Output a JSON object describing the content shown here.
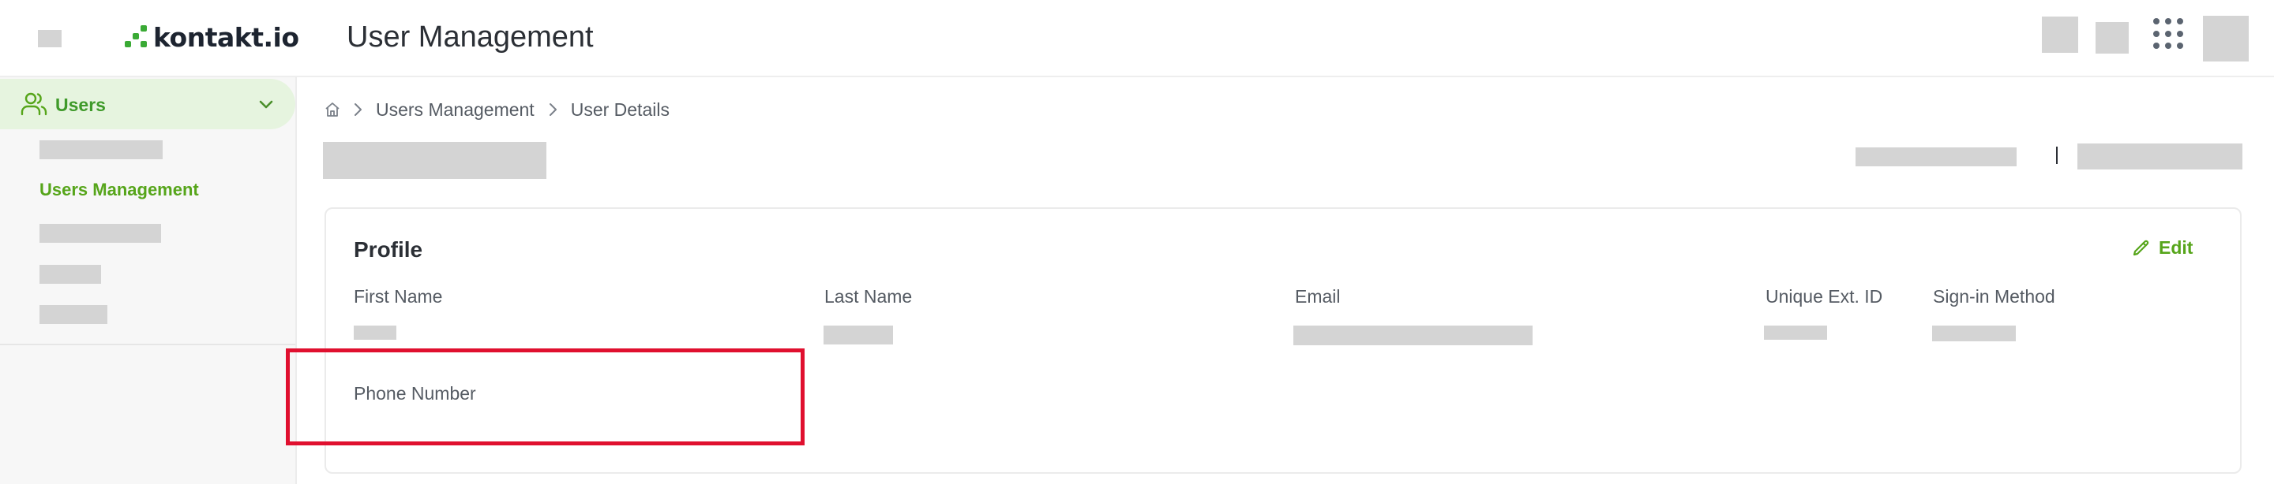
{
  "app": {
    "logo_text": "kontakt.io",
    "title": "User Management",
    "brand_color": "#56a51a"
  },
  "sidebar": {
    "section_label": "Users",
    "section_icon": "users-icon",
    "active_item_label": "Users Management"
  },
  "breadcrumb": {
    "items": [
      "Users Management",
      "User Details"
    ]
  },
  "profile": {
    "title": "Profile",
    "edit_label": "Edit",
    "fields": {
      "first_name_label": "First Name",
      "last_name_label": "Last Name",
      "email_label": "Email",
      "unique_ext_id_label": "Unique Ext. ID",
      "sign_in_method_label": "Sign-in Method",
      "phone_number_label": "Phone Number"
    }
  },
  "highlight_color": "#e0102f"
}
